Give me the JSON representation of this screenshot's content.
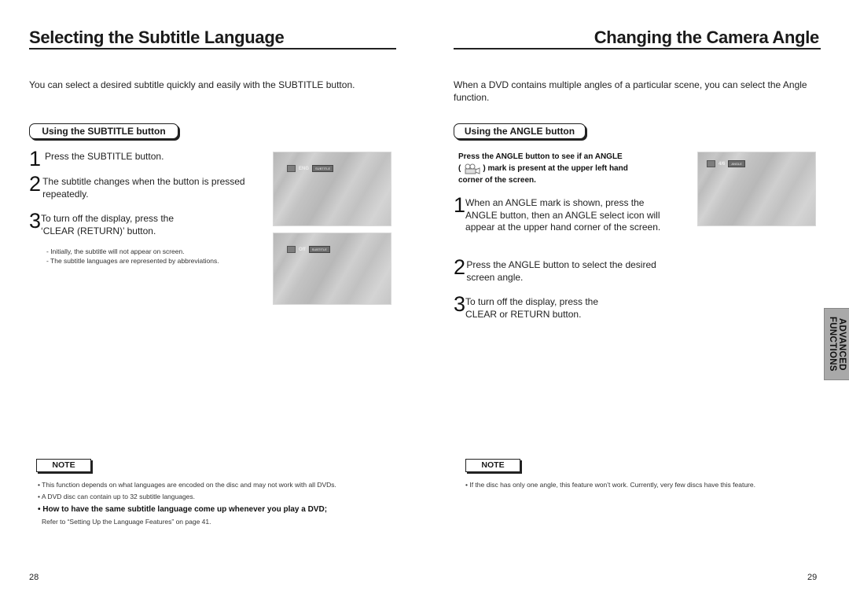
{
  "left_page": {
    "title": "Selecting the Subtitle Language",
    "intro": "You can select a desired subtitle quickly and easily with the SUBTITLE button.",
    "section_label": "Using the SUBTITLE button",
    "steps": [
      {
        "num": "1",
        "text": "Press the SUBTITLE button."
      },
      {
        "num": "2",
        "text": "The subtitle changes when the button is pressed repeatedly."
      },
      {
        "num": "3",
        "text": "To turn off the display, press the ‘CLEAR (RETURN)’ button."
      }
    ],
    "sub_notes": [
      "- Initially, the subtitle will not appear on screen.",
      "- The subtitle languages are represented by abbreviations."
    ],
    "screens": [
      {
        "osd_value": "ENG",
        "osd_badge": "SUBTITLE"
      },
      {
        "osd_value": "Off",
        "osd_badge": "SUBTITLE"
      }
    ],
    "note_label": "NOTE",
    "notes": [
      "• This function depends on what languages are encoded on the disc and may not work with all DVDs.",
      "• A DVD disc can contain up to 32 subtitle languages."
    ],
    "tip_heading": "• How to have the same subtitle language come up whenever you play a DVD;",
    "tip_text": "Refer to “Setting Up the Language Features” on page 41.",
    "page_number": "28"
  },
  "right_page": {
    "title": "Changing the Camera Angle",
    "intro": "When a DVD contains multiple angles of a particular scene, you can select the Angle function.",
    "section_label": "Using the ANGLE button",
    "bold_intro_line1": "Press the ANGLE button to see if an ANGLE",
    "bold_intro_line2_pre": "(",
    "bold_intro_line2_post": ") mark is present at the upper left hand",
    "bold_intro_line3": "corner of the screen.",
    "angle_icon": "camera-angle-icon",
    "steps": [
      {
        "num": "1",
        "text": "When an ANGLE mark is shown, press the ANGLE button, then an ANGLE select icon will appear at the upper hand corner of the screen."
      },
      {
        "num": "2",
        "text": "Press the ANGLE button to select the desired screen angle."
      },
      {
        "num": "3",
        "text": "To turn off the display, press the CLEAR or RETURN button."
      }
    ],
    "screen": {
      "osd_value": "4/6",
      "osd_badge": "ANGLE"
    },
    "side_tab": {
      "line1": "ADVANCED",
      "line2": "FUNCTIONS"
    },
    "note_label": "NOTE",
    "notes": [
      "• If the disc has only one angle, this feature won’t work. Currently, very few discs have this feature."
    ],
    "page_number": "29"
  }
}
